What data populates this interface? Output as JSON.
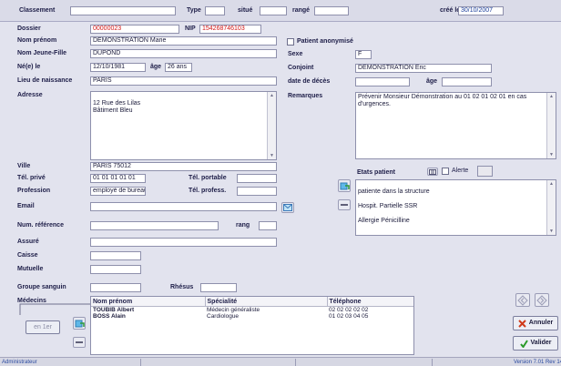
{
  "top": {
    "classement_label": "Classement",
    "classement_value": "",
    "type_label": "Type",
    "type_value": "",
    "situe_label": "situé",
    "situe_value": "",
    "range_label": "rangé",
    "range_value": "",
    "cree_label": "créé le",
    "cree_value": "30/10/2007"
  },
  "patient": {
    "dossier_label": "Dossier",
    "dossier_value": "00000023",
    "nip_label": "NIP",
    "nip_value": "154268746103",
    "nom_prenom_label": "Nom prénom",
    "nom_prenom_value": "DEMONSTRATION Marie",
    "nom_jeune_fille_label": "Nom Jeune-Fille",
    "nom_jeune_fille_value": "DUPOND",
    "ne_le_label": "Né(e) le",
    "ne_le_value": "12/10/1981",
    "age_label": "âge",
    "age_value": "26 ans",
    "lieu_naissance_label": "Lieu de naissance",
    "lieu_naissance_value": "PARIS",
    "adresse_label": "Adresse",
    "adresse_value": "12 Rue des Lilas\nBâtiment Bleu",
    "ville_label": "Ville",
    "ville_value": "PARIS 75012",
    "tel_prive_label": "Tél. privé",
    "tel_prive_value": "01 01 01 01 01",
    "tel_portable_label": "Tél. portable",
    "tel_portable_value": "",
    "profession_label": "Profession",
    "profession_value": "employé de bureau",
    "tel_profess_label": "Tél. profess.",
    "tel_profess_value": "",
    "email_label": "Email",
    "email_value": "",
    "num_reference_label": "Num. référence",
    "num_reference_value": "",
    "rang_label": "rang",
    "rang_value": "",
    "assure_label": "Assuré",
    "assure_value": "",
    "caisse_label": "Caisse",
    "caisse_value": "",
    "mutuelle_label": "Mutuelle",
    "mutuelle_value": "",
    "groupe_sanguin_label": "Groupe sanguin",
    "groupe_sanguin_value": "",
    "rhesus_label": "Rhésus",
    "rhesus_value": ""
  },
  "right": {
    "patient_anonymise_label": "Patient anonymisé",
    "patient_anonymise_checked": false,
    "sexe_label": "Sexe",
    "sexe_value": "F",
    "conjoint_label": "Conjoint",
    "conjoint_value": "DEMONSTRATION Eric",
    "date_deces_label": "date de décès",
    "date_deces_value": "",
    "age_label": "âge",
    "age_value": "",
    "remarques_label": "Remarques",
    "remarques_value": "Prévenir Monsieur Démonstration au 01 02 01 02 01 en cas d'urgences.",
    "etats_label": "Etats patient",
    "alerte_label": "Alerte",
    "alerte_checked": false,
    "etats_items": [
      "patiente dans la structure",
      "Hospit. Partielle SSR",
      "Allergie Pénicilline"
    ]
  },
  "medecins": {
    "label": "Médecins",
    "columns": [
      "Nom prénom",
      "Spécialité",
      "Téléphone"
    ],
    "rows": [
      {
        "nom": "TOUBIB Albert",
        "specialite": "Médecin généraliste",
        "telephone": "02 02 02 02 02"
      },
      {
        "nom": "BOSS Alain",
        "specialite": "Cardiologue",
        "telephone": "01 02 03 04 05"
      }
    ],
    "en_1er_label": "en 1er"
  },
  "buttons": {
    "annuler_label": "Annuler",
    "valider_label": "Valider"
  },
  "status": {
    "user": "Administrateur",
    "version": "Version 7.01 Rev 14"
  },
  "colors": {
    "accent_red": "#d21616",
    "status_blue": "#2a4aa0"
  }
}
